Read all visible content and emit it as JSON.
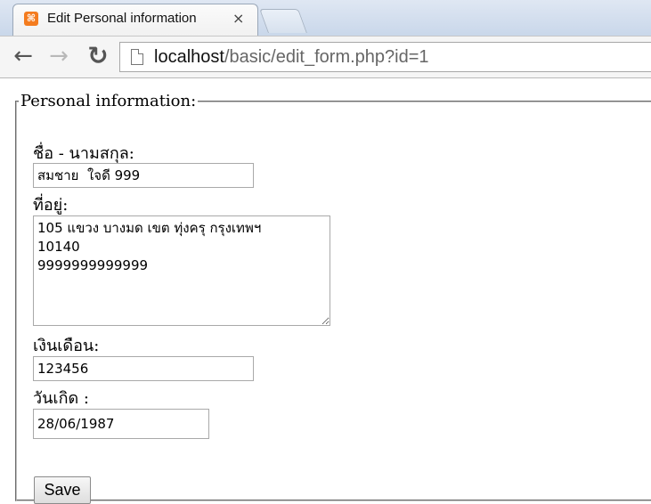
{
  "browser": {
    "tab": {
      "title": "Edit Personal information",
      "close_icon": "×",
      "favicon": "xampp-icon"
    },
    "address": {
      "host": "localhost",
      "path": "/basic/edit_form.php?id=1"
    },
    "nav": {
      "back_icon": "←",
      "forward_icon": "→",
      "reload_icon": "↻",
      "page_icon": "page-icon"
    }
  },
  "form": {
    "legend": "Personal information:",
    "name_label": "ชื่อ - นามสกุล:",
    "name_value": "สมชาย  ใจดี 999",
    "address_label": "ที่อยู่:",
    "address_value": "105 แขวง บางมด เขต ทุ่งครุ กรุงเทพฯ\n10140\n9999999999999",
    "salary_label": "เงินเดือน:",
    "salary_value": "123456",
    "birthdate_label": "วันเกิด :",
    "birthdate_value": "28/06/1987",
    "save_label": "Save"
  },
  "colors": {
    "favicon": "#f47c1f",
    "tab_strip": "#c9d7ea"
  }
}
